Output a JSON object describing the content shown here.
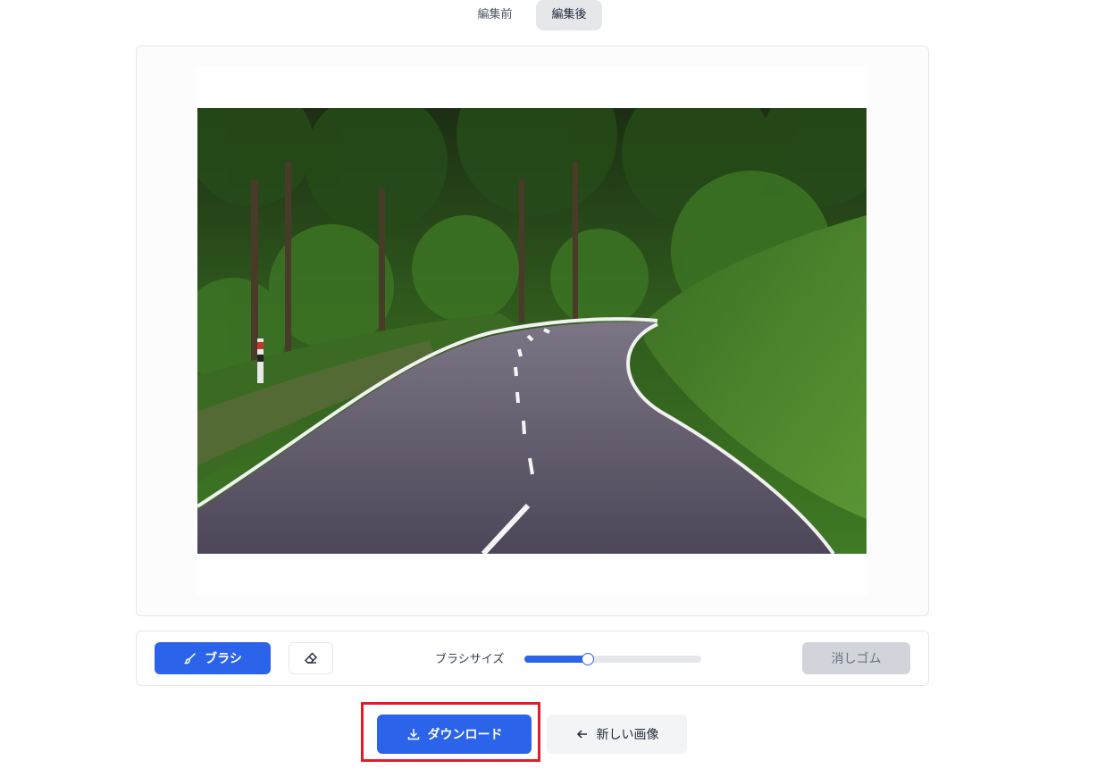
{
  "tabs": [
    {
      "label": "編集前",
      "active": false
    },
    {
      "label": "編集後",
      "active": true
    }
  ],
  "canvas": {
    "image_description_icon": "road-photo"
  },
  "toolbar": {
    "brush_label": "ブラシ",
    "brush_icon": "brush-icon",
    "eraser_icon": "eraser-icon",
    "size_label": "ブラシサイズ",
    "brush_size_fraction": 0.36,
    "erase_action_label": "消しゴム"
  },
  "actions": {
    "download_label": "ダウンロード",
    "download_icon": "download-icon",
    "new_image_label": "新しい画像",
    "new_image_icon": "arrow-left-icon"
  },
  "colors": {
    "accent": "#2b63ea",
    "highlight": "#e11d2a",
    "disabled": "#d1d5db"
  }
}
